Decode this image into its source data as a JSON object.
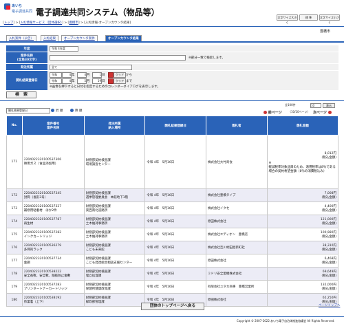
{
  "header": {
    "logo_line1": "あいち",
    "logo_line2": "電子調達共同",
    "title": "電子調達共同システム（物品等）",
    "font_large": "文字サイズ大きく",
    "font_std": "標 準",
    "font_small": "文字サイズ小さく"
  },
  "breadcrumb": {
    "top": "トップ",
    "info": "入札情報サービス（団体選択）",
    "org": "豊橋市",
    "current": "入札情報-オープンカウンタ結果"
  },
  "org_name": "豊橋市",
  "tabs": [
    "入札案件（公告）",
    "入札結果",
    "オープンカウンタ案件",
    "オープンカウンタ結果"
  ],
  "form": {
    "year_label": "年度",
    "year_value": "令和 4年度",
    "name_label": "案件名称",
    "name_sub": "(全角30文字)",
    "name_hint": "※部分一致で検索します。",
    "dept_label": "発注所属",
    "dept_value": "全て",
    "date_label": "開札結果登録日",
    "era1": "令和",
    "y1": "4",
    "m1": "4",
    "d1": "1",
    "unit_year": "年",
    "unit_month": "月",
    "unit_day": "日",
    "clear1": "クリア",
    "from": "から",
    "era2": "令和",
    "y2": "4",
    "m2": "5",
    "d2": "19",
    "clear2": "クリア",
    "to": "まで",
    "date_note": "※画像を押下すると日付を指定するためのカレンダーダイアログを表示します。",
    "search_button": "検　索"
  },
  "list_controls": {
    "sort_value": "開札結果登録日",
    "asc": "昇 順",
    "desc": "降 順",
    "count_label": "全100件",
    "per_page": "10",
    "show": "表示",
    "prev": "前ページ",
    "page_info": "（10/10ページ）",
    "next": "次ページ"
  },
  "table": {
    "headers": {
      "no": "No.",
      "case": "案件番号\n案件名称",
      "dept": "発注所属\n納入場所",
      "date": "開札結果登録日",
      "winner": "落札者",
      "amount": "落札金額"
    },
    "rows": [
      {
        "no": "171",
        "case_no": "2204022320100537306",
        "case_name": "徴用ガス（食品添加用）",
        "dept": "財務部契約検査課",
        "place": "環境調査センター",
        "date": "令和 4年　5月16日",
        "winner": "株式会社大竹商会",
        "amount": "8,012円",
        "amount_note": "(税込金額)",
        "extra": "※\n軽減税率対象品目のため、適用税率は8％である場合の契約希望金額（8％の消費税込み）"
      },
      {
        "no": "172",
        "case_no": "2204022320100537345",
        "case_name": "封筒（長形3号）",
        "dept": "財務部契約検査課",
        "place": "選挙管理委員会　本館地下1階",
        "date": "令和 4年　5月16日",
        "winner": "株式会社豊橋タイプ",
        "amount": "7,008円",
        "amount_note": "(税込金額)"
      },
      {
        "no": "173",
        "case_no": "2204022320100537327",
        "case_name": "補修用粘着材　ほか2件",
        "dept": "財務部契約検査課",
        "place": "東西南北道路所",
        "date": "令和 4年　5月16日",
        "winner": "株式会社イクセ",
        "amount": "4,400円",
        "amount_note": "(税込金額)"
      },
      {
        "no": "174",
        "case_no": "2204022320100537787",
        "case_name": "再生材",
        "dept": "財務部契約検査課",
        "place": "土木維持事務所",
        "date": "令和 4年　5月16日",
        "winner": "原田株式会社",
        "amount": "121,000円",
        "amount_note": "(税込金額)"
      },
      {
        "no": "175",
        "case_no": "2204022320100537282",
        "case_name": "インクカートリッジ",
        "dept": "財務部契約検査課",
        "place": "土木維持事務所",
        "date": "令和 4年　5月16日",
        "winner": "株式会社エディオン　豊橋店",
        "amount": "100,980円",
        "amount_note": "(税込金額)"
      },
      {
        "no": "176",
        "case_no": "2204022320100536279",
        "case_name": "多目的ラック",
        "dept": "財務部契約検査課",
        "place": "こども未来館",
        "date": "令和 4年　5月16日",
        "winner": "株式会社吉川村田屋新町社",
        "amount": "38,310円",
        "amount_note": "(税込金額)"
      },
      {
        "no": "177",
        "case_no": "2204022320100537734",
        "case_name": "金鋼",
        "dept": "財務部契約検査課",
        "place": "こども発達総合相談支援センター",
        "date": "令和 4年　5月16日",
        "winner": "原田株式会社",
        "amount": "6,468円",
        "amount_note": "(税込金額)"
      },
      {
        "no": "178",
        "case_no": "2204022320100538222",
        "case_name": "安全長靴、安全靴、踏抜防止金敷",
        "dept": "財務部契約検査課",
        "place": "埋立処理課",
        "date": "令和 4年　5月16日",
        "winner": "ミドリ安全愛機株式会社",
        "amount": "69,649円",
        "amount_note": "(税込金額)"
      },
      {
        "no": "179",
        "case_no": "2204022320100537283",
        "case_name": "プリンタートナーカートリッジ",
        "dept": "財務部契約検査課",
        "place": "保健所健康政策課",
        "date": "令和 4年　5月16日",
        "winner": "有限会社ユタカ商事　豊橋営業所",
        "amount": "132,000円",
        "amount_note": "(税込金額)"
      },
      {
        "no": "180",
        "case_no": "2204022320100538192",
        "case_name": "作業着（上下）",
        "dept": "財務部契約検査課",
        "place": "緑政部管理課",
        "date": "令和 4年　5月16日",
        "winner": "原田株式会社",
        "amount": "65,250円",
        "amount_note": "(税込金額)"
      }
    ]
  },
  "bottom": {
    "return_button": "団体のトップページへ戻る",
    "page_top": "ページトップへ"
  },
  "footer": {
    "copyright": "Copyright © 2007-2022 あいち電子自治体推進協議会 All Rights Reserved."
  },
  "colors": {
    "primary": "#2a63b8",
    "accent": "#cc3333",
    "row_alt": "#ececf6"
  }
}
